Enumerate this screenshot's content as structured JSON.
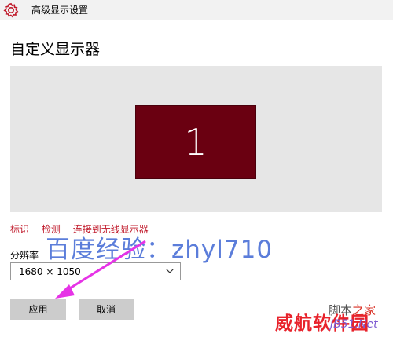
{
  "window": {
    "title": "高级显示设置",
    "icon": "gear-icon"
  },
  "page": {
    "title": "自定义显示器"
  },
  "display": {
    "number": "1",
    "color": "#6a0011"
  },
  "links": {
    "identify": "标识",
    "detect": "检测",
    "wireless": "连接到无线显示器"
  },
  "watermark": {
    "main": "百度经验：zhyl710",
    "jb_a": "脚本",
    "jb_b": "之家",
    "site_a": "威航软件园",
    "site_b": "JB51.Net"
  },
  "resolution": {
    "label": "分辨率",
    "value": "1680 × 1050"
  },
  "buttons": {
    "apply": "应用",
    "cancel": "取消"
  },
  "colors": {
    "accent_link": "#c0192a",
    "arrow": "#e633e6"
  }
}
